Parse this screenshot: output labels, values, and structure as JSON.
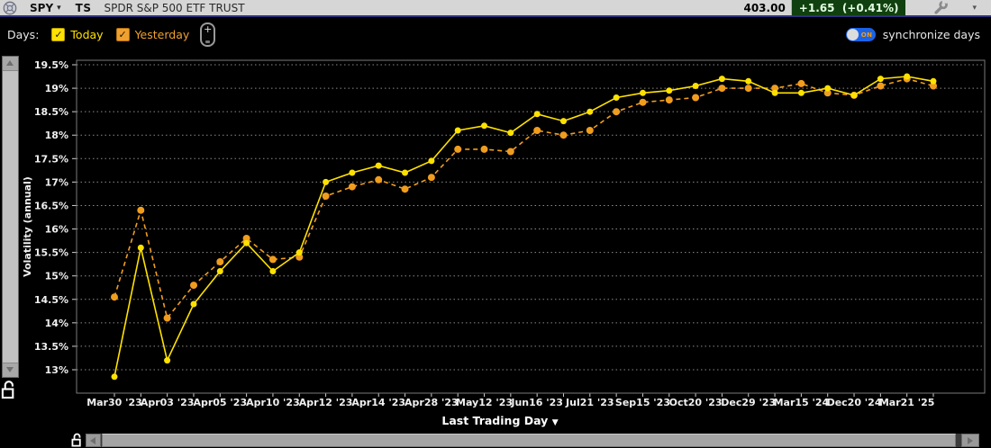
{
  "header": {
    "symbol": "SPY",
    "ts_label": "TS",
    "title": "SPDR S&P 500 ETF TRUST",
    "price": "403.00",
    "change": "+1.65  (+0.41%)",
    "change_bg_color": "#10400f"
  },
  "toolbar": {
    "days_label": "Days:",
    "checkboxes": [
      {
        "label": "Today",
        "checked": true,
        "color": "#ffe100"
      },
      {
        "label": "Yesterday",
        "checked": true,
        "color": "#f0a030"
      }
    ],
    "toggle_label": "ON",
    "sync_label": "synchronize days"
  },
  "icons": {
    "check": "✓",
    "plus": "+",
    "down_arrow": "▼",
    "down_arrow_small": "▾"
  },
  "chart_data": {
    "type": "line",
    "title": "",
    "xlabel": "Last Trading Day",
    "ylabel": "Volatility (annual)",
    "ylim": [
      12.7,
      19.6
    ],
    "grid": "horizontal-dashed",
    "legend_position": "none",
    "y_ticks": [
      {
        "v": 19.5,
        "label": "19.5%"
      },
      {
        "v": 19.0,
        "label": "19%"
      },
      {
        "v": 18.5,
        "label": "18.5%"
      },
      {
        "v": 18.0,
        "label": "18%"
      },
      {
        "v": 17.5,
        "label": "17.5%"
      },
      {
        "v": 17.0,
        "label": "17%"
      },
      {
        "v": 16.5,
        "label": "16.5%"
      },
      {
        "v": 16.0,
        "label": "16%"
      },
      {
        "v": 15.5,
        "label": "15.5%"
      },
      {
        "v": 15.0,
        "label": "15%"
      },
      {
        "v": 14.5,
        "label": "14.5%"
      },
      {
        "v": 14.0,
        "label": "14%"
      },
      {
        "v": 13.5,
        "label": "13.5%"
      },
      {
        "v": 13.0,
        "label": "13%"
      }
    ],
    "x_tick_labels": [
      "Mar30 '23",
      "Apr03 '23",
      "Apr05 '23",
      "Apr10 '23",
      "Apr12 '23",
      "Apr14 '23",
      "Apr28 '23",
      "May12 '23",
      "Jun16 '23",
      "Jul21 '23",
      "Sep15 '23",
      "Oct20 '23",
      "Dec29 '23",
      "Mar15 '24",
      "Dec20 '24",
      "Mar21 '25"
    ],
    "points_per_label": 2,
    "series": [
      {
        "name": "Today",
        "style": "solid",
        "color": "#ffe100",
        "values": [
          12.85,
          15.6,
          13.2,
          14.4,
          15.1,
          15.7,
          15.1,
          15.5,
          17.0,
          17.2,
          17.35,
          17.2,
          17.45,
          18.1,
          18.2,
          18.05,
          18.45,
          18.3,
          18.5,
          18.8,
          18.9,
          18.95,
          19.05,
          19.2,
          19.15,
          18.9,
          18.9,
          19.0,
          18.85,
          19.2,
          19.25,
          19.15
        ]
      },
      {
        "name": "Yesterday",
        "style": "dashed",
        "color": "#f09d1e",
        "values": [
          14.55,
          16.4,
          14.1,
          14.8,
          15.3,
          15.8,
          15.35,
          15.4,
          16.7,
          16.9,
          17.05,
          16.85,
          17.1,
          17.7,
          17.7,
          17.65,
          18.1,
          18.0,
          18.1,
          18.5,
          18.7,
          18.75,
          18.8,
          19.0,
          19.0,
          19.0,
          19.1,
          18.9,
          18.85,
          19.05,
          19.2,
          19.05
        ]
      }
    ]
  }
}
